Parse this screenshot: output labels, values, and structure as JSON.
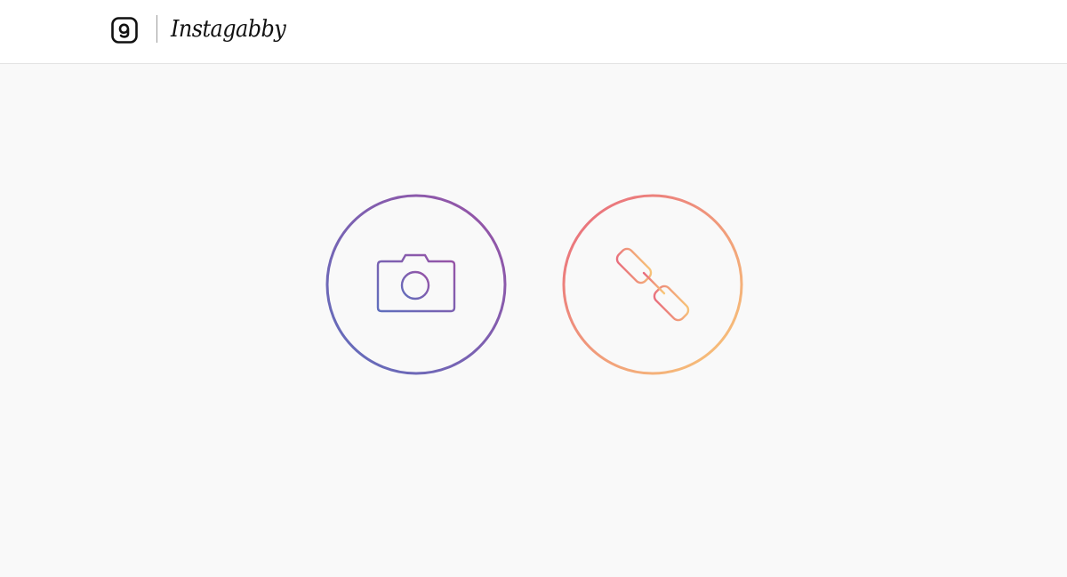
{
  "header": {
    "logo_icon": "instagram-camera-icon",
    "brand_name": "Instagabby"
  },
  "actions": [
    {
      "id": "camera",
      "icon": "camera-icon",
      "gradient": [
        "#5f6fbd",
        "#9a52a5"
      ]
    },
    {
      "id": "link",
      "icon": "link-icon",
      "gradient": [
        "#e8697e",
        "#f8c878"
      ]
    }
  ],
  "colors": {
    "page_background": "#f9f9f9",
    "header_background": "#ffffff",
    "header_border": "#e3e3e3",
    "logo_ink": "#111111"
  }
}
